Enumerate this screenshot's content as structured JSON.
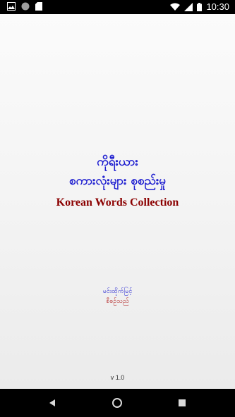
{
  "status_bar": {
    "time": "10:30",
    "icons_left": [
      "image-icon",
      "circle-icon",
      "sd-card-icon"
    ],
    "icons_right": [
      "wifi-icon",
      "signal-icon",
      "battery-icon"
    ]
  },
  "splash": {
    "title_line1": "ကိုရီးယား",
    "title_line2": "စကားလုံးများ စုစည်းမှု",
    "title_en": "Korean Words Collection",
    "author_name": "မင်းထိုက်မြင့်",
    "author_role": "စီစဉ်သည်",
    "version": "v 1.0"
  },
  "colors": {
    "title_blue": "#1d1dd0",
    "title_red": "#8b0000",
    "author_blue": "#1d1dd0",
    "author_red": "#b22222"
  },
  "nav_bar": {
    "buttons": [
      "back-icon",
      "home-icon",
      "recents-icon"
    ]
  }
}
